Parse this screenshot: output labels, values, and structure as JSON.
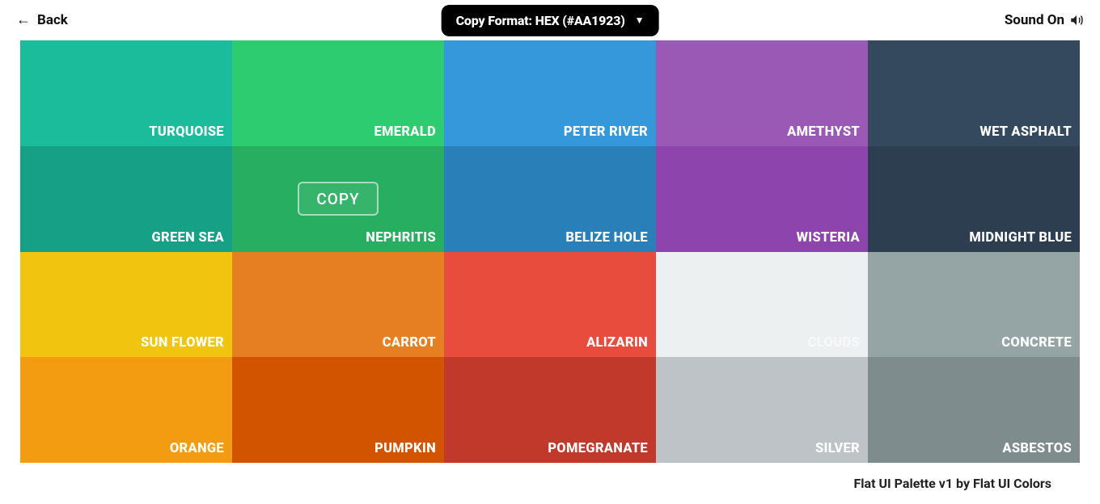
{
  "header": {
    "back_label": "Back",
    "copy_format_label": "Copy Format: HEX (#AA1923)",
    "sound_label": "Sound On"
  },
  "copy_button_label": "COPY",
  "hovered_index": 6,
  "swatches": [
    {
      "name": "TURQUOISE",
      "hex": "#1abc9c",
      "light_label": false
    },
    {
      "name": "EMERALD",
      "hex": "#2ecc71",
      "light_label": false
    },
    {
      "name": "PETER RIVER",
      "hex": "#3498db",
      "light_label": false
    },
    {
      "name": "AMETHYST",
      "hex": "#9b59b6",
      "light_label": false
    },
    {
      "name": "WET ASPHALT",
      "hex": "#34495e",
      "light_label": false
    },
    {
      "name": "GREEN SEA",
      "hex": "#16a085",
      "light_label": false
    },
    {
      "name": "NEPHRITIS",
      "hex": "#27ae60",
      "light_label": false
    },
    {
      "name": "BELIZE HOLE",
      "hex": "#2980b9",
      "light_label": false
    },
    {
      "name": "WISTERIA",
      "hex": "#8e44ad",
      "light_label": false
    },
    {
      "name": "MIDNIGHT BLUE",
      "hex": "#2c3e50",
      "light_label": false
    },
    {
      "name": "SUN FLOWER",
      "hex": "#f1c40f",
      "light_label": false
    },
    {
      "name": "CARROT",
      "hex": "#e67e22",
      "light_label": false
    },
    {
      "name": "ALIZARIN",
      "hex": "#e74c3c",
      "light_label": false
    },
    {
      "name": "CLOUDS",
      "hex": "#ecf0f1",
      "light_label": true
    },
    {
      "name": "CONCRETE",
      "hex": "#95a5a6",
      "light_label": false
    },
    {
      "name": "ORANGE",
      "hex": "#f39c12",
      "light_label": false
    },
    {
      "name": "PUMPKIN",
      "hex": "#d35400",
      "light_label": false
    },
    {
      "name": "POMEGRANATE",
      "hex": "#c0392b",
      "light_label": false
    },
    {
      "name": "SILVER",
      "hex": "#bdc3c7",
      "light_label": false
    },
    {
      "name": "ASBESTOS",
      "hex": "#7f8c8d",
      "light_label": false
    }
  ],
  "footer": {
    "credit": "Flat UI Palette v1 by Flat UI Colors"
  }
}
